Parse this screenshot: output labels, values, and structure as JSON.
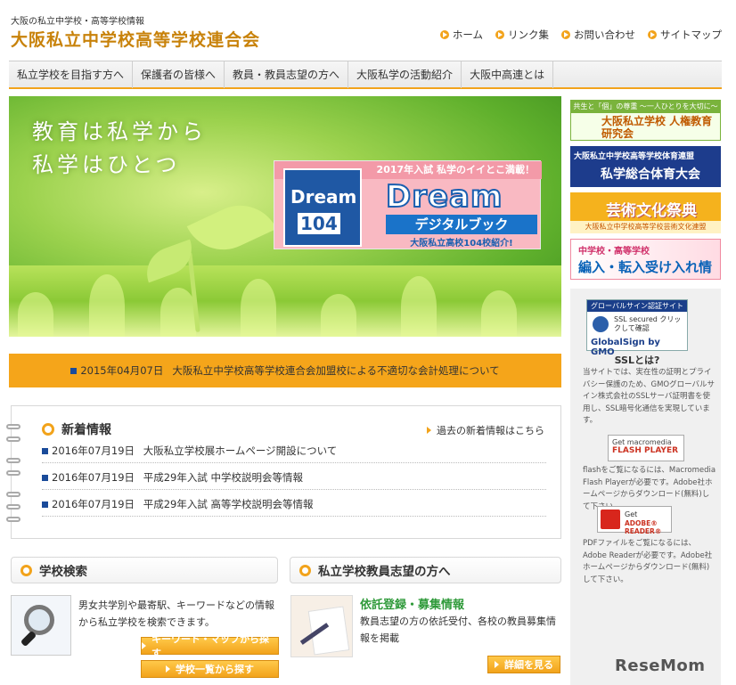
{
  "header": {
    "subtitle": "大阪の私立中学校・高等学校情報",
    "title": "大阪私立中学校高等学校連合会",
    "links": [
      "ホーム",
      "リンク集",
      "お問い合わせ",
      "サイトマップ"
    ]
  },
  "nav": {
    "items": [
      "私立学校を目指す方へ",
      "保護者の皆様へ",
      "教員・教員志望の方へ",
      "大阪私学の活動紹介",
      "大阪中高連とは"
    ]
  },
  "hero": {
    "line1": "教育は私学から",
    "line2": "私学はひとつ",
    "banner": {
      "top": "2017年入試 私学のイイとこ満載！",
      "book_word": "Dream",
      "book_num": "104",
      "logo": "Dream",
      "sub": "デジタルブック",
      "caption": "大阪私立高校104校紹介!"
    }
  },
  "notice": {
    "date": "2015年04月07日",
    "text": "大阪私立中学校高等学校連合会加盟校による不適切な会計処理について"
  },
  "news": {
    "title": "新着情報",
    "more": "過去の新着情報はこちら",
    "items": [
      {
        "date": "2016年07月19日",
        "text": "大阪私立学校展ホームページ開設について"
      },
      {
        "date": "2016年07月19日",
        "text": "平成29年入試 中学校説明会等情報"
      },
      {
        "date": "2016年07月19日",
        "text": "平成29年入試 高等学校説明会等情報"
      }
    ]
  },
  "school_search": {
    "title": "学校検索",
    "desc": "男女共学別や最寄駅、キーワードなどの情報から私立学校を検索できます。",
    "btn_keyword": "キーワード・マップから探す",
    "btn_list": "学校一覧から探す"
  },
  "teacher": {
    "title": "私立学校教員志望の方へ",
    "sub": "依託登録・募集情報",
    "desc": "教員志望の方の依託受付、各校の教員募集情報を掲載",
    "btn_detail": "詳細を見る"
  },
  "sidebar": {
    "banner1_top": "共生と「個」の尊重 ～一人ひとりを大切に～",
    "banner1_main": "大阪私立学校 人権教育研究会",
    "banner2_top": "大阪私立中学校高等学校体育連盟",
    "banner2_main": "私学総合体育大会",
    "banner3_main": "芸術文化祭典",
    "banner3_bot": "大阪私立中学校高等学校芸術文化連盟",
    "banner4_top": "中学校・高等学校",
    "banner4_main": "編入・転入受け入れ情報",
    "ssl_top": "グローバルサイン認証サイト",
    "ssl_text": "SSL secured クリックして確認",
    "ssl_brand": "GlobalSign by GMO",
    "ssl_link": "SSLとは?",
    "ssl_desc": "当サイトでは、実在性の証明とプライバシー保護のため、GMOグローバルサイン株式会社のSSLサーバ証明書を使用し、SSL暗号化通信を実現しています。",
    "flash_b1": "Get macromedia",
    "flash_b2": "FLASH PLAYER",
    "flash_desc": "flashをご覧になるには、Macromedia Flash Playerが必要です。Adobe社ホームページからダウンロード(無料)して下さい。",
    "adobe_b1": "Get",
    "adobe_b2": "ADOBE® READER®",
    "pdf_desc": "PDFファイルをご覧になるには、Adobe Readerが必要です。Adobe社ホームページからダウンロード(無料)して下さい。"
  },
  "watermark": "ReseMom"
}
